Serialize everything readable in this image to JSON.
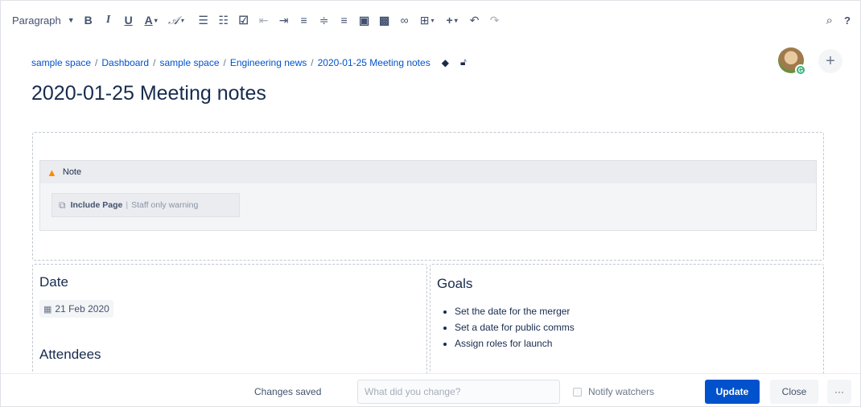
{
  "toolbar": {
    "paragraph_label": "Paragraph",
    "icons": [
      "bold-icon",
      "italic-icon",
      "underline-icon",
      "text-color-icon",
      "clear-format-icon",
      "bullet-list-icon",
      "numbered-list-icon",
      "task-list-icon",
      "outdent-icon",
      "indent-icon",
      "align-left-icon",
      "align-center-icon",
      "align-right-icon",
      "layout-icon",
      "image-icon",
      "link-icon",
      "table-icon",
      "insert-icon",
      "undo-icon",
      "redo-icon",
      "search-icon",
      "help-icon"
    ]
  },
  "breadcrumb": {
    "items": [
      "sample space",
      "Dashboard",
      "sample space",
      "Engineering news",
      "2020-01-25 Meeting notes"
    ],
    "separator": "/"
  },
  "page": {
    "title": "2020-01-25 Meeting notes"
  },
  "note": {
    "title": "Note",
    "include_title": "Include Page",
    "include_sep": "|",
    "include_param": "Staff only warning"
  },
  "date_section": {
    "heading": "Date",
    "date_value": "21 Feb 2020"
  },
  "attendees_section": {
    "heading": "Attendees"
  },
  "goals_section": {
    "heading": "Goals",
    "items": [
      "Set the date for the merger",
      "Set a date for public comms",
      "Assign roles for launch"
    ]
  },
  "bottom": {
    "status": "Changes saved",
    "change_placeholder": "What did you change?",
    "notify_label": "Notify watchers",
    "update_label": "Update",
    "close_label": "Close",
    "more_label": "···"
  },
  "colors": {
    "primary": "#0052cc",
    "warning": "#ff8b00",
    "presence": "#36b37e"
  }
}
